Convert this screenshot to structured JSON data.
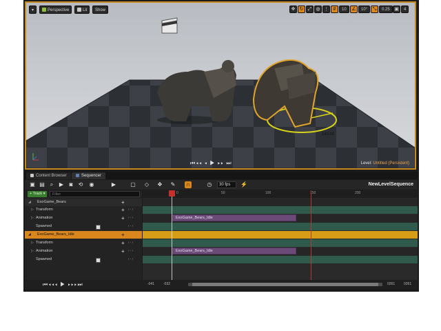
{
  "viewport": {
    "perspective_label": "Perspective",
    "lit_label": "Lit",
    "show_label": "Show",
    "grid_snap_value": "10",
    "rotation_snap_value": "10°",
    "scale_snap_value": "0.25",
    "camera_speed_value": "4",
    "distance_label": "140.00",
    "level_prefix": "Level:",
    "level_name": "Untitled (Persistent)",
    "transport_hud": "⏮◂◂ ◂ ▶ ▸▸ ⏭"
  },
  "tabs": {
    "content_browser": "Content Browser",
    "sequencer": "Sequencer"
  },
  "toolbar": {
    "fps_value": "30 fps",
    "sequence_name": "NewLevelSequence"
  },
  "outliner": {
    "track_button": "+ Track ▾",
    "filter_placeholder": "Filter",
    "rows": [
      {
        "label": "ExoGame_Bears"
      },
      {
        "label": "Transform"
      },
      {
        "label": "Animation"
      },
      {
        "label": "Spawned"
      },
      {
        "label": "ExoGame_Bears_Idle"
      },
      {
        "label": "Transform"
      },
      {
        "label": "Animation"
      },
      {
        "label": "Spawned"
      }
    ]
  },
  "timeline": {
    "ticks": [
      "0",
      "50",
      "100",
      "150",
      "200"
    ],
    "sections": [
      {
        "label": "ExoGame_Bears_Idle"
      },
      {
        "label": "ExoGame_Bears_Idle"
      }
    ]
  },
  "bottom": {
    "view_start": "-041",
    "work_start": "-032",
    "work_end": "0261",
    "view_end": "0261"
  },
  "colors": {
    "accent": "#d9861c",
    "track_green": "#2f5a4c",
    "section_purple": "#6b4a78",
    "selected_track": "#d79d16",
    "playhead_red": "#c4302b"
  }
}
